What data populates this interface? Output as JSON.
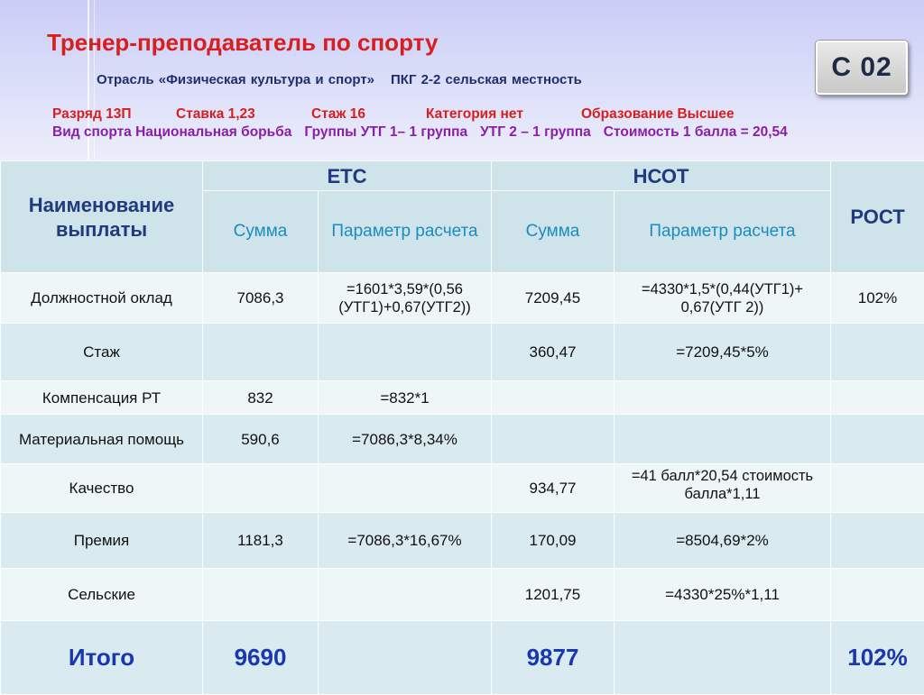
{
  "header": {
    "title": "Тренер-преподаватель по спорту",
    "industry": "Отрасль «Физическая культура и спорт»",
    "pkg": "ПКГ 2-2 сельская  местность",
    "code": "С 02",
    "details_row1": [
      "Разряд 13П",
      "Ставка 1,23",
      "Стаж 16",
      "Категория нет",
      "Образование Высшее"
    ],
    "details_row2": [
      "Вид спорта Национальная борьба",
      "Группы  УТГ 1– 1 группа",
      "УТГ 2 – 1 группа",
      "Стоимость 1 балла = 20,54"
    ]
  },
  "table": {
    "col_name": "Наименование выплаты",
    "group_etc": "ЕТС",
    "group_nsot": "НСОТ",
    "col_growth": "РОСТ",
    "sub_sum": "Сумма",
    "sub_param_etc": "Параметр расчета",
    "sub_param_nsot": "Параметр расчета",
    "rows": [
      {
        "name": "Должностной оклад",
        "etc_sum": "7086,3",
        "etc_param": "=1601*3,59*(0,56 (УТГ1)+0,67(УТГ2))",
        "nsot_sum": "7209,45",
        "nsot_param": "=4330*1,5*(0,44(УТГ1)+ 0,67(УТГ 2))",
        "growth": "102%"
      },
      {
        "name": "Стаж",
        "etc_sum": "",
        "etc_param": "",
        "nsot_sum": "360,47",
        "nsot_param": "=7209,45*5%",
        "growth": ""
      },
      {
        "name": "Компенсация РТ",
        "etc_sum": "832",
        "etc_param": "=832*1",
        "nsot_sum": "",
        "nsot_param": "",
        "growth": ""
      },
      {
        "name": "Материальная помощь",
        "etc_sum": "590,6",
        "etc_param": "=7086,3*8,34%",
        "nsot_sum": "",
        "nsot_param": "",
        "growth": ""
      },
      {
        "name": "Качество",
        "etc_sum": "",
        "etc_param": "",
        "nsot_sum": "934,77",
        "nsot_param": "=41 балл*20,54 стоимость балла*1,11",
        "growth": ""
      },
      {
        "name": "Премия",
        "etc_sum": "1181,3",
        "etc_param": "=7086,3*16,67%",
        "nsot_sum": "170,09",
        "nsot_param": "=8504,69*2%",
        "growth": ""
      },
      {
        "name": "Сельские",
        "etc_sum": "",
        "etc_param": "",
        "nsot_sum": "1201,75",
        "nsot_param": "=4330*25%*1,11",
        "growth": ""
      }
    ],
    "total": {
      "name": "Итого",
      "etc_sum": "9690",
      "etc_param": "",
      "nsot_sum": "9877",
      "nsot_param": "",
      "growth": "102%"
    }
  }
}
